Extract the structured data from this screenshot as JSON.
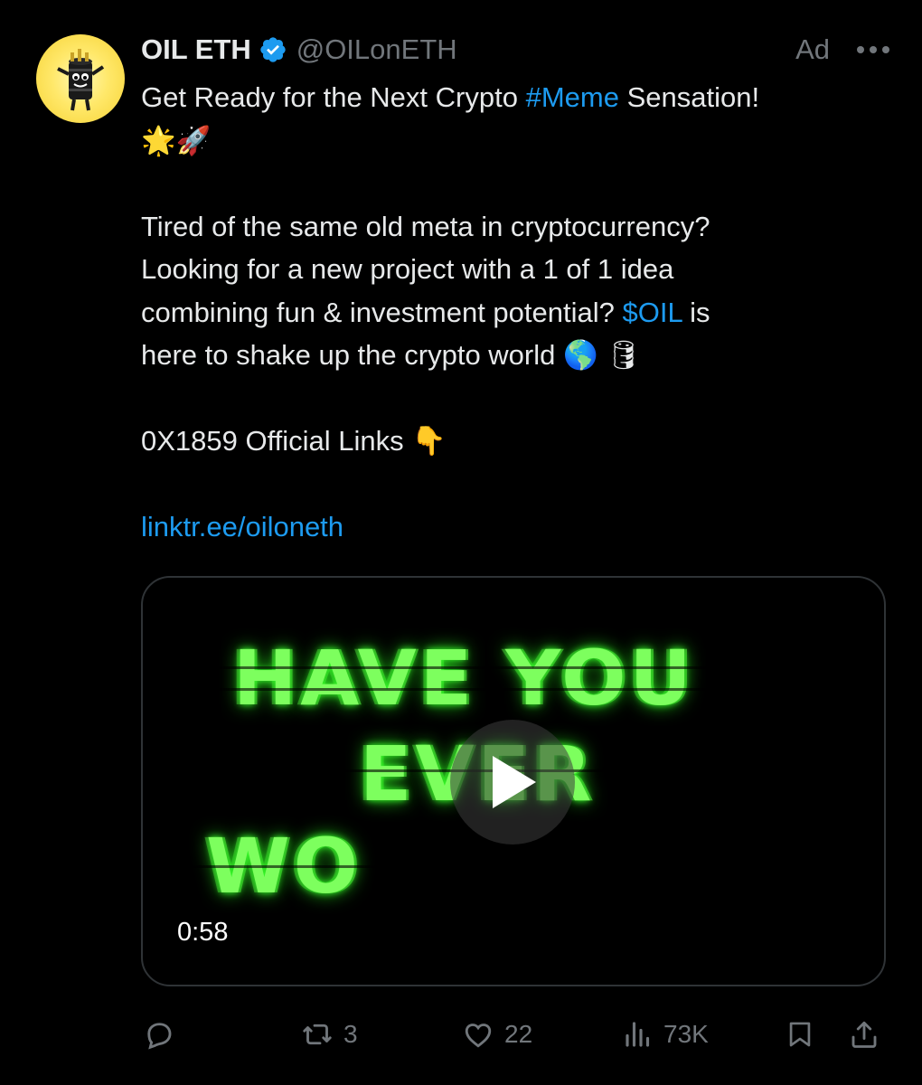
{
  "account": {
    "display_name": "OIL ETH",
    "handle": "@OILonETH",
    "ad_label": "Ad",
    "avatar_icon": "oil-barrel-mascot-avatar",
    "verified_icon": "verified-badge-icon",
    "verified_color": "#1d9bf0"
  },
  "tweet": {
    "line1_pre": "Get Ready for the Next Crypto ",
    "line1_hashtag": "#Meme",
    "line1_post": " Sensation!",
    "line2_emojis": "🌟🚀",
    "p2_line1": "Tired of the same old meta in cryptocurrency?",
    "p2_line2": "Looking for a new project with a 1 of 1 idea",
    "p2_line3_pre": "combining fun & investment potential? ",
    "p2_line3_cashtag": "$OIL",
    "p2_line3_post": " is",
    "p2_line4": "here to shake up the crypto world",
    "p2_line4_emojis": "🌎 🛢",
    "p3_line1": "0X1859 Official Links",
    "p3_emoji": "👇",
    "link": "linktr.ee/oiloneth"
  },
  "media": {
    "frame_line1": "HAVE YOU",
    "frame_line2": "EVER",
    "frame_line3": "WO",
    "duration": "0:58",
    "play_icon": "play-icon"
  },
  "actions": {
    "reply_count": "",
    "retweet_count": "3",
    "like_count": "22",
    "views_count": "73K"
  },
  "colors": {
    "background": "#000000",
    "text": "#e7e9ea",
    "secondary": "#71767b",
    "link": "#1d9bf0",
    "glitch_green": "#7dff5e"
  }
}
